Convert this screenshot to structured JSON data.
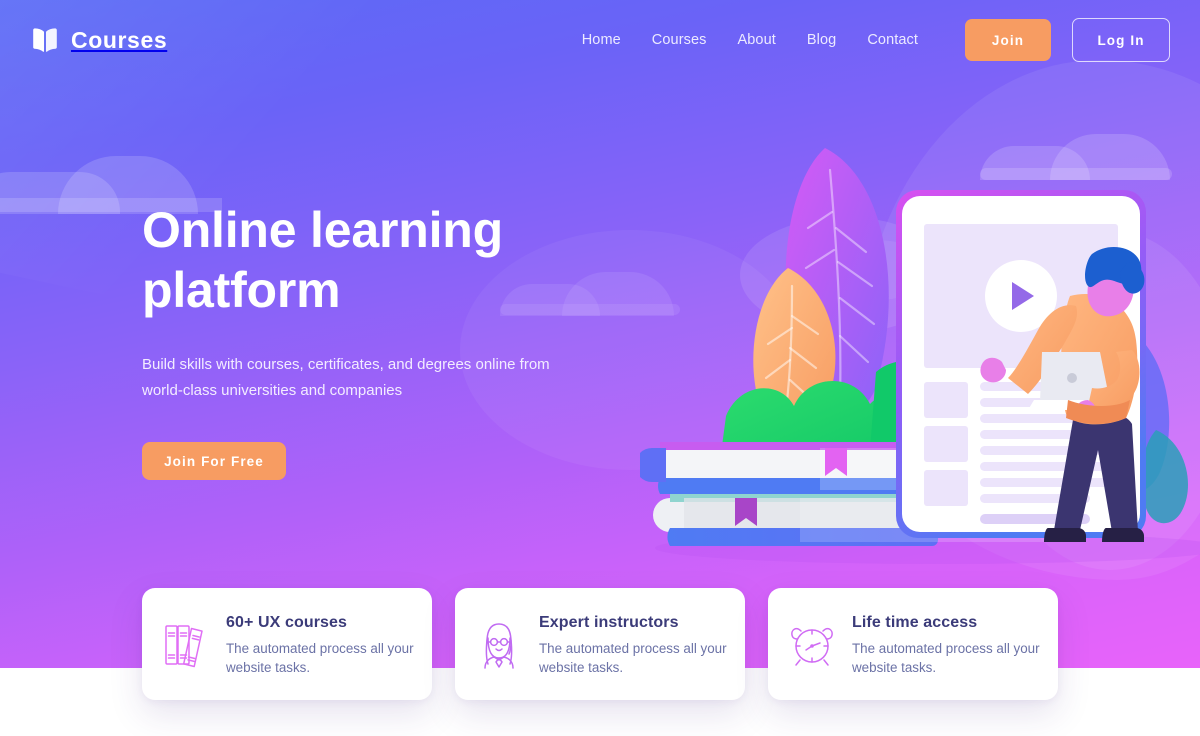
{
  "brand": {
    "name": "Courses",
    "logo_icon": "open-book-icon"
  },
  "nav": {
    "items": [
      {
        "label": "Home"
      },
      {
        "label": "Courses"
      },
      {
        "label": "About"
      },
      {
        "label": "Blog"
      },
      {
        "label": "Contact"
      }
    ]
  },
  "actions": {
    "join_label": "Join",
    "login_label": "Log In"
  },
  "hero": {
    "title": "Online learning platform",
    "subtitle": "Build skills with courses, certificates, and degrees online from world-class universities and companies",
    "cta_label": "Join For Free",
    "illustration": "student-tablet-books-illustration"
  },
  "features": [
    {
      "icon": "books-icon",
      "title": "60+ UX courses",
      "description": "The automated process all your website tasks."
    },
    {
      "icon": "instructor-icon",
      "title": "Expert instructors",
      "description": "The automated process all your website tasks."
    },
    {
      "icon": "alarm-clock-icon",
      "title": "Life time access",
      "description": "The automated process all your website tasks."
    }
  ],
  "colors": {
    "gradient_start": "#5a6bf6",
    "gradient_end": "#e863fa",
    "accent_orange": "#f79c62",
    "card_title": "#3b3b79",
    "card_text": "#6b72a6",
    "icon_outline": "#e06ff5"
  }
}
